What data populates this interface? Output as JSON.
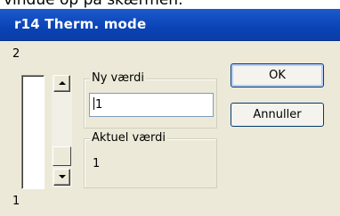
{
  "top_caption": "vindue op på skærmen.",
  "window": {
    "title": "r14 Therm. mode"
  },
  "scale": {
    "max_label": "2",
    "min_label": "1"
  },
  "new_value": {
    "label": "Ny værdi",
    "value": "1"
  },
  "current_value": {
    "label": "Aktuel værdi",
    "value": "1"
  },
  "buttons": {
    "ok": "OK",
    "cancel": "Annuller"
  },
  "icons": {
    "scroll_up": "arrow-up-icon",
    "scroll_down": "arrow-down-icon"
  }
}
